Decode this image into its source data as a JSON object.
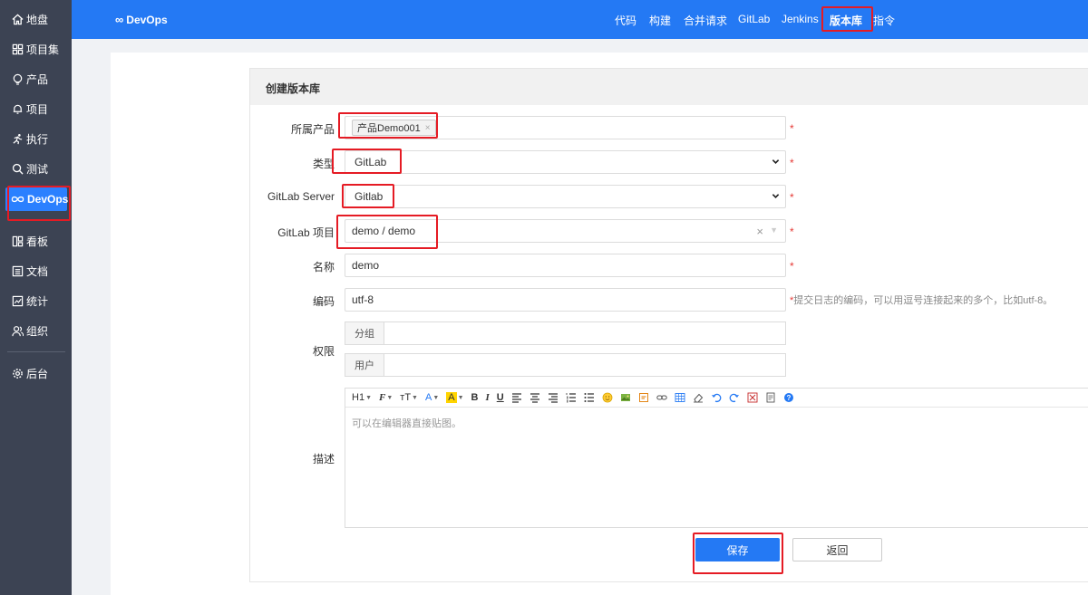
{
  "sidebar": {
    "items": [
      {
        "label": "地盘",
        "icon": "home-icon"
      },
      {
        "label": "项目集",
        "icon": "grid-icon"
      },
      {
        "label": "产品",
        "icon": "lightbulb-icon"
      },
      {
        "label": "项目",
        "icon": "bell-icon"
      },
      {
        "label": "执行",
        "icon": "run-icon"
      },
      {
        "label": "测试",
        "icon": "search-icon"
      },
      {
        "label": "DevOps",
        "icon": "infinity-icon"
      },
      {
        "label": "看板",
        "icon": "kanban-icon"
      },
      {
        "label": "文档",
        "icon": "document-icon"
      },
      {
        "label": "统计",
        "icon": "chart-icon"
      },
      {
        "label": "组织",
        "icon": "people-icon"
      },
      {
        "label": "后台",
        "icon": "gear-icon"
      }
    ]
  },
  "header": {
    "logo": "DevOps",
    "nav": [
      "代码",
      "构建",
      "合并请求",
      "GitLab",
      "Jenkins",
      "版本库",
      "指令"
    ],
    "active_nav": "版本库"
  },
  "form": {
    "title": "创建版本库",
    "product_label": "所属产品",
    "product_tag": "产品Demo001",
    "type_label": "类型",
    "type_value": "GitLab",
    "server_label": "GitLab Server",
    "server_value": "Gitlab",
    "project_label": "GitLab 项目",
    "project_value": "demo / demo",
    "name_label": "名称",
    "name_value": "demo",
    "encoding_label": "编码",
    "encoding_value": "utf-8",
    "encoding_hint": "提交日志的编码，可以用逗号连接起来的多个，比如utf-8。",
    "required_mark": "*",
    "acl_label": "权限",
    "acl_group": "分组",
    "acl_user": "用户",
    "desc_label": "描述",
    "editor_placeholder": "可以在编辑器直接贴图。",
    "save": "保存",
    "back": "返回"
  },
  "toolbar": {
    "heading": "H1",
    "font": "F",
    "size": "тT",
    "color": "A",
    "bg": "A",
    "bold": "B",
    "italic": "I",
    "underline": "U"
  },
  "colors": {
    "sidebar": "#3c4353",
    "header": "#2479f4",
    "accent": "#2b80ff",
    "highlight": "#e51b24"
  }
}
